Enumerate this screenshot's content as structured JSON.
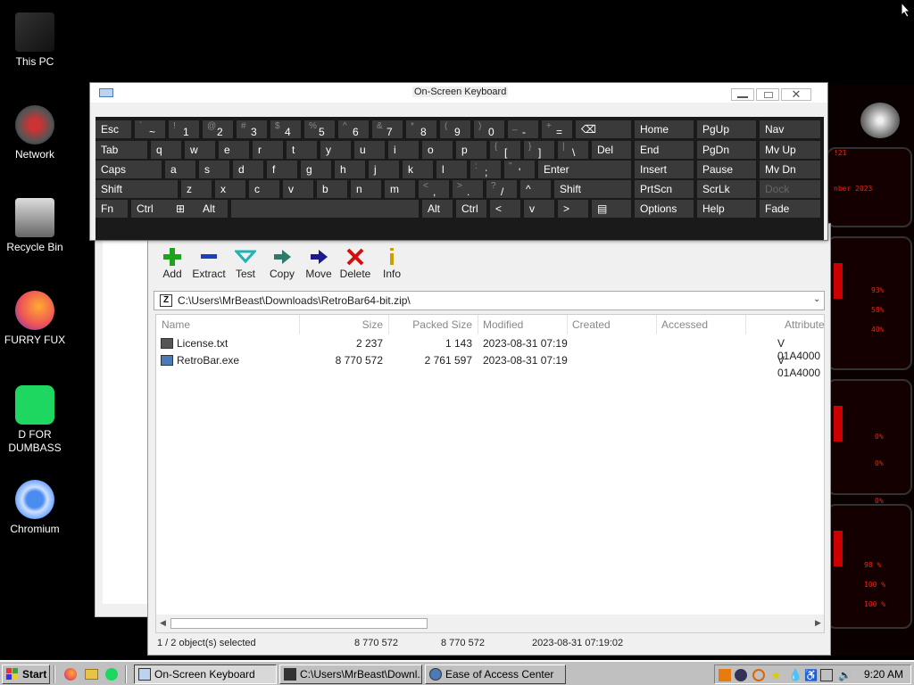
{
  "desktop_icons": [
    {
      "label": "This PC",
      "icon": "computer-icon"
    },
    {
      "label": "Network",
      "icon": "network-icon"
    },
    {
      "label": "Recycle Bin",
      "icon": "recycle-bin-icon"
    },
    {
      "label": "FURRY FUX",
      "icon": "firefox-icon"
    },
    {
      "label": "D FOR\nDUMBASS",
      "icon": "spotify-icon"
    },
    {
      "label": "Chromium",
      "icon": "chromium-icon"
    }
  ],
  "osk": {
    "title": "On-Screen Keyboard",
    "rows": [
      [
        {
          "main": "Esc",
          "shift": ""
        },
        {
          "main": "~",
          "shift": "`",
          "pair": true
        },
        {
          "main": "1",
          "shift": "!"
        },
        {
          "main": "2",
          "shift": "@"
        },
        {
          "main": "3",
          "shift": "#"
        },
        {
          "main": "4",
          "shift": "$"
        },
        {
          "main": "5",
          "shift": "%"
        },
        {
          "main": "6",
          "shift": "^"
        },
        {
          "main": "7",
          "shift": "&"
        },
        {
          "main": "8",
          "shift": "*"
        },
        {
          "main": "9",
          "shift": "("
        },
        {
          "main": "0",
          "shift": ")"
        },
        {
          "main": "-",
          "shift": "_"
        },
        {
          "main": "=",
          "shift": "+"
        },
        {
          "main": "⌫",
          "shift": ""
        }
      ],
      [
        {
          "main": "Tab"
        },
        {
          "main": "q"
        },
        {
          "main": "w"
        },
        {
          "main": "e"
        },
        {
          "main": "r"
        },
        {
          "main": "t"
        },
        {
          "main": "y"
        },
        {
          "main": "u"
        },
        {
          "main": "i"
        },
        {
          "main": "o"
        },
        {
          "main": "p"
        },
        {
          "main": "[",
          "shift": "{"
        },
        {
          "main": "]",
          "shift": "}"
        },
        {
          "main": "\\",
          "shift": "|"
        },
        {
          "main": "Del"
        }
      ],
      [
        {
          "main": "Caps"
        },
        {
          "main": "a"
        },
        {
          "main": "s"
        },
        {
          "main": "d"
        },
        {
          "main": "f"
        },
        {
          "main": "g"
        },
        {
          "main": "h"
        },
        {
          "main": "j"
        },
        {
          "main": "k"
        },
        {
          "main": "l"
        },
        {
          "main": ";",
          "shift": ":"
        },
        {
          "main": "'",
          "shift": "\""
        },
        {
          "main": "Enter"
        }
      ],
      [
        {
          "main": "Shift"
        },
        {
          "main": "z"
        },
        {
          "main": "x"
        },
        {
          "main": "c"
        },
        {
          "main": "v"
        },
        {
          "main": "b"
        },
        {
          "main": "n"
        },
        {
          "main": "m"
        },
        {
          "main": ",",
          "shift": "<"
        },
        {
          "main": ".",
          "shift": ">"
        },
        {
          "main": "/",
          "shift": "?"
        },
        {
          "main": "^"
        },
        {
          "main": "Shift"
        }
      ],
      [
        {
          "main": "Fn"
        },
        {
          "main": "Ctrl"
        },
        {
          "main": "⊞"
        },
        {
          "main": "Alt"
        },
        {
          "main": ""
        },
        {
          "main": "Alt"
        },
        {
          "main": "Ctrl"
        },
        {
          "main": "<"
        },
        {
          "main": "v"
        },
        {
          "main": ">"
        },
        {
          "main": "▤"
        }
      ]
    ],
    "nav": [
      [
        "Home",
        "PgUp",
        "Nav"
      ],
      [
        "End",
        "PgDn",
        "Mv Up"
      ],
      [
        "Insert",
        "Pause",
        "Mv Dn"
      ],
      [
        "PrtScn",
        "ScrLk",
        "Dock"
      ],
      [
        "Options",
        "Help",
        "Fade"
      ]
    ]
  },
  "zip": {
    "toolbar": [
      {
        "label": "Add",
        "icon": "add-icon",
        "color": "#1fa31f"
      },
      {
        "label": "Extract",
        "icon": "extract-icon",
        "color": "#1b3fbf"
      },
      {
        "label": "Test",
        "icon": "test-icon",
        "color": "#1fb3b3"
      },
      {
        "label": "Copy",
        "icon": "copy-icon",
        "color": "#2d7a6a"
      },
      {
        "label": "Move",
        "icon": "move-icon",
        "color": "#1b1b8f"
      },
      {
        "label": "Delete",
        "icon": "delete-icon",
        "color": "#d01010"
      },
      {
        "label": "Info",
        "icon": "info-icon",
        "color": "#c8a000"
      }
    ],
    "path": "C:\\Users\\MrBeast\\Downloads\\RetroBar64-bit.zip\\",
    "columns": [
      "Name",
      "Size",
      "Packed Size",
      "Modified",
      "Created",
      "Accessed",
      "Attribute"
    ],
    "files": [
      {
        "name": "License.txt",
        "size": "2 237",
        "packed": "1 143",
        "modified": "2023-08-31 07:19",
        "attr": "V 01A4000"
      },
      {
        "name": "RetroBar.exe",
        "size": "8 770 572",
        "packed": "2 761 597",
        "modified": "2023-08-31 07:19",
        "attr": "V 01A4000"
      }
    ],
    "status": {
      "selected": "1 / 2 object(s) selected",
      "size": "8 770 572",
      "packed": "8 770 572",
      "modified": "2023-08-31 07:19:02"
    }
  },
  "widget": {
    "texts": [
      "!21",
      "nber 2023",
      "93%",
      "58%",
      "40%",
      "0%",
      "0%",
      "0%",
      "98 %",
      "100 %",
      "100 %"
    ]
  },
  "taskbar": {
    "start": "Start",
    "tasks": [
      {
        "label": "On-Screen Keyboard",
        "icon": "keyboard-icon",
        "pressed": true
      },
      {
        "label": "C:\\Users\\MrBeast\\Downl...",
        "icon": "7zip-icon",
        "pressed": false
      },
      {
        "label": "Ease of Access Center",
        "icon": "ease-of-access-icon",
        "pressed": false
      }
    ],
    "clock": "9:20 AM"
  },
  "colors": {
    "desktop": "#000000",
    "osk_key": "#3a3a3a",
    "taskbar": "#c0c0c0",
    "widget_red": "#e21"
  }
}
